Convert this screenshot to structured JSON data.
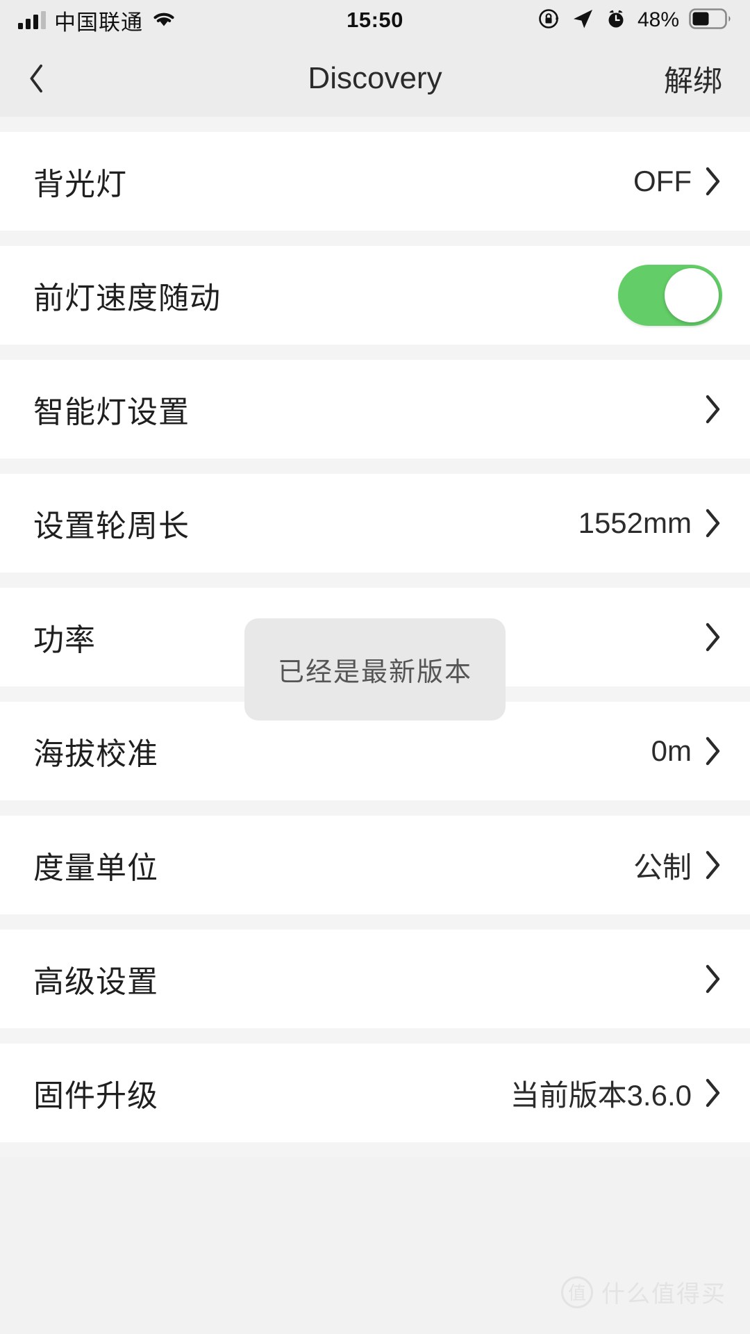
{
  "statusbar": {
    "carrier": "中国联通",
    "time": "15:50",
    "battery_percent": "48%",
    "signal_bars_filled": 3,
    "signal_bars_total": 4,
    "icons": [
      "signal-bars-icon",
      "wifi-icon",
      "rotation-lock-icon",
      "location-arrow-icon",
      "alarm-clock-icon",
      "battery-icon"
    ]
  },
  "navbar": {
    "back_icon": "chevron-left-icon",
    "title": "Discovery",
    "action_label": "解绑"
  },
  "settings": {
    "rows": [
      {
        "label": "背光灯",
        "value": "OFF",
        "control": "chevron"
      },
      {
        "label": "前灯速度随动",
        "value": "",
        "control": "toggle",
        "toggle_on": true
      },
      {
        "label": "智能灯设置",
        "value": "",
        "control": "chevron"
      },
      {
        "label": "设置轮周长",
        "value": "1552mm",
        "control": "chevron"
      },
      {
        "label": "功率",
        "value": "",
        "control": "chevron"
      },
      {
        "label": "海拔校准",
        "value": "0m",
        "control": "chevron"
      },
      {
        "label": "度量单位",
        "value": "公制",
        "control": "chevron"
      },
      {
        "label": "高级设置",
        "value": "",
        "control": "chevron"
      },
      {
        "label": "固件升级",
        "value": "当前版本3.6.0",
        "control": "chevron"
      }
    ]
  },
  "toast": {
    "message": "已经是最新版本"
  },
  "watermark": {
    "badge": "值",
    "text": "什么值得买"
  },
  "colors": {
    "toggle_on": "#63ce67",
    "page_background": "#f4f4f4",
    "bar_background": "#ececec",
    "row_background": "#ffffff",
    "text_primary": "#1f1f1f",
    "toast_background": "#e8e8e8"
  }
}
